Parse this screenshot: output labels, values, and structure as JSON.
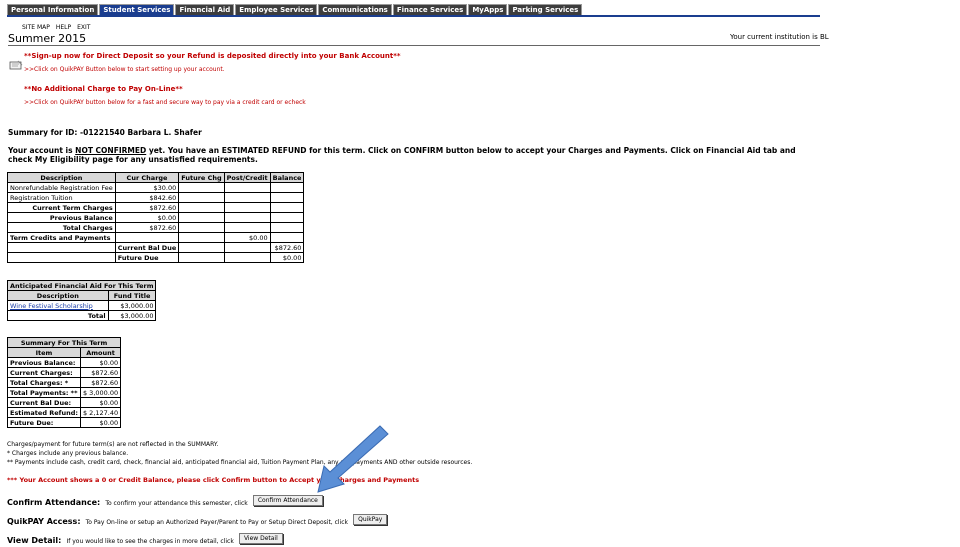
{
  "tabs": [
    "Personal Information",
    "Student Services",
    "Financial Aid",
    "Employee Services",
    "Communications",
    "Finance Services",
    "MyApps",
    "Parking Services"
  ],
  "active_tab": 1,
  "sublinks": [
    "SITE MAP",
    "HELP",
    "EXIT"
  ],
  "page_title": "Summer 2015",
  "institution_note": "Your current institution is BL",
  "direct_deposit": {
    "heading": "**Sign-up now for Direct Deposit so your Refund is deposited directly into your Bank Account**",
    "sub": ">>Click on QuikPAY Button below to start setting up your account."
  },
  "pay_online": {
    "heading": "**No Additional Charge to Pay On-Line**",
    "sub": ">>Click on QuikPAY button below for a fast and secure way to pay via a credit card or echeck"
  },
  "summary_line": "Summary for ID: -01221540 Barbara L. Shafer",
  "account_status": {
    "prefix": "Your account is ",
    "not_confirmed": "NOT CONFIRMED",
    "rest": " yet. You have an ESTIMATED REFUND for this term. Click on CONFIRM button below to accept your Charges and Payments. Click on Financial Aid tab and check My Eligibility page for any unsatisfied requirements."
  },
  "charges_table": {
    "headers": [
      "Description",
      "Cur Charge",
      "Future Chg",
      "Post/Credit",
      "Balance"
    ],
    "rows": [
      {
        "desc": "Nonrefundable Registration Fee",
        "cur": "$30.00",
        "future": "",
        "post": "",
        "bal": ""
      },
      {
        "desc": "Registration Tuition",
        "cur": "$842.60",
        "future": "",
        "post": "",
        "bal": ""
      },
      {
        "desc": "Current Term Charges",
        "cur": "$872.60",
        "future": "",
        "post": "",
        "bal": ""
      },
      {
        "desc": "Previous Balance",
        "cur": "$0.00",
        "future": "",
        "post": "",
        "bal": ""
      },
      {
        "desc": "Total Charges",
        "cur": "$872.60",
        "future": "",
        "post": "",
        "bal": ""
      },
      {
        "desc": "Term Credits and Payments",
        "cur": "",
        "future": "",
        "post": "$0.00",
        "bal": ""
      },
      {
        "desc": "",
        "cur": "Current Bal Due",
        "future": "",
        "post": "",
        "bal": "$872.60"
      },
      {
        "desc": "",
        "cur": "Future Due",
        "future": "",
        "post": "",
        "bal": "$0.00"
      }
    ]
  },
  "aid_table": {
    "title": "Anticipated Financial Aid For This Term",
    "headers": [
      "Description",
      "Fund Title"
    ],
    "rows": [
      {
        "desc": "Wine Festival Scholarship",
        "amt": "$3,000.00"
      },
      {
        "desc": "Total",
        "amt": "$3,000.00"
      }
    ]
  },
  "summary_table": {
    "title": "Summary For This Term",
    "headers": [
      "Item",
      "Amount"
    ],
    "rows": [
      {
        "item": "Previous Balance:",
        "amt": "$0.00"
      },
      {
        "item": "Current Charges:",
        "amt": "$872.60"
      },
      {
        "item": "Total Charges: *",
        "amt": "$872.60"
      },
      {
        "item": "Total Payments: **",
        "amt": "$ 3,000.00"
      },
      {
        "item": "Current Bal Due:",
        "amt": "$0.00"
      },
      {
        "item": "Estimated Refund:",
        "amt": "$ 2,127.40"
      },
      {
        "item": "Future Due:",
        "amt": "$0.00"
      }
    ]
  },
  "footnotes": [
    "Charges/payment for future term(s) are not reflected in the SUMMARY.",
    "* Charges include any previous balance.",
    "** Payments include cash, credit card, check, financial aid, anticipated financial aid, Tuition Payment Plan, any pre-payments AND other outside resources."
  ],
  "credit_notice": "*** Your Account shows a 0 or Credit Balance, please click Confirm button to Accept your Charges and Payments",
  "confirm": {
    "label": "Confirm Attendance:",
    "desc": "To confirm your attendance this semester, click",
    "button": "Confirm Attendance"
  },
  "quikpay": {
    "label": "QuikPAY Access:",
    "desc": "To Pay On-line or setup an Authorized Payer/Parent to Pay or Setup Direct Deposit, click",
    "button": "QuikPay"
  },
  "view_detail": {
    "label": "View Detail:",
    "desc": "If you would like to see the charges in more detail, click",
    "button": "View Detail"
  },
  "colors": {
    "tab_bg": "#3d3d3d",
    "tab_active": "#1a3d8f",
    "notice_red": "#c00000",
    "arrow": "#5b8fd6"
  },
  "icons": [
    "note-icon",
    "arrow-pointer-icon"
  ]
}
